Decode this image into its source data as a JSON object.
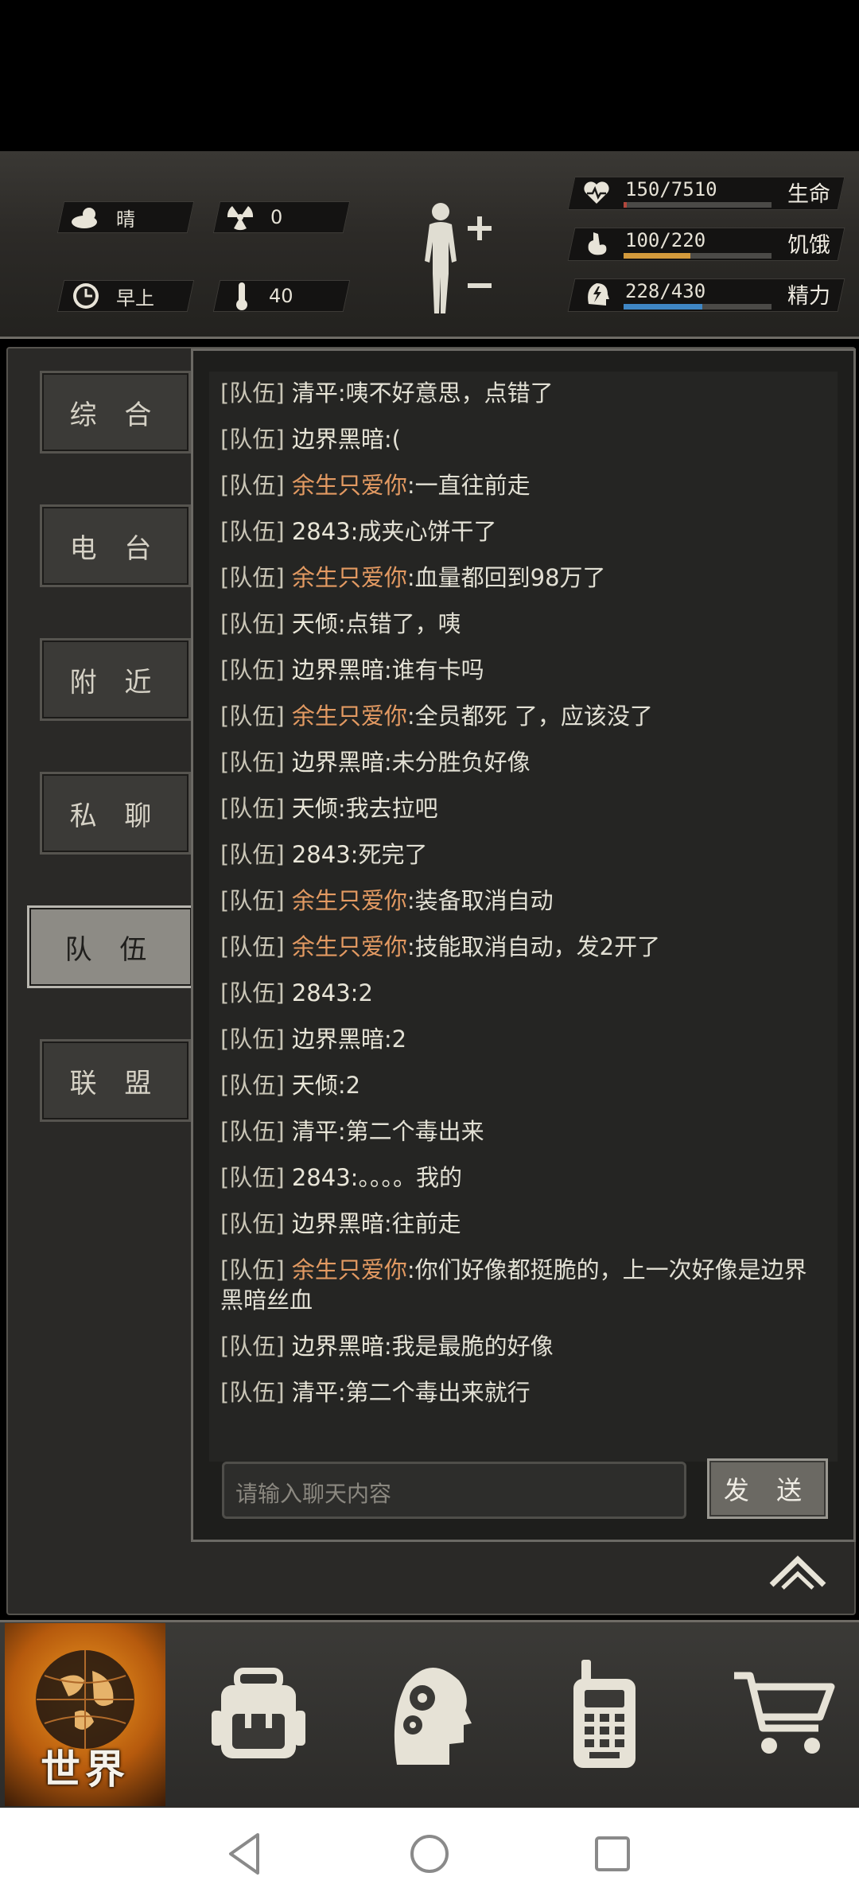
{
  "status": {
    "weather": "晴",
    "radiation": "0",
    "time_of_day": "早上",
    "temperature": "40"
  },
  "stats": [
    {
      "value": "150/7510",
      "label": "生命",
      "icon": "heart-pulse-icon",
      "fraction": 0.02,
      "color": "#b2473c"
    },
    {
      "value": "100/220",
      "label": "饥饿",
      "icon": "stomach-icon",
      "fraction": 0.45,
      "color": "#d39a3c"
    },
    {
      "value": "228/430",
      "label": "精力",
      "icon": "energy-head-icon",
      "fraction": 0.53,
      "color": "#3f86c4"
    }
  ],
  "tabs": [
    "综 合",
    "电 台",
    "附 近",
    "私 聊",
    "队 伍",
    "联 盟"
  ],
  "active_tab": "队 伍",
  "messages": [
    {
      "tag": "[队伍]",
      "name": "清平",
      "self": false,
      "text": ":咦不好意思，点错了"
    },
    {
      "tag": "[队伍]",
      "name": "边界黑暗",
      "self": false,
      "text": ":("
    },
    {
      "tag": "[队伍]",
      "name": "余生只爱你",
      "self": true,
      "text": ":一直往前走"
    },
    {
      "tag": "[队伍]",
      "name": "2843",
      "self": false,
      "text": ":成夹心饼干了"
    },
    {
      "tag": "[队伍]",
      "name": "余生只爱你",
      "self": true,
      "text": ":血量都回到98万了"
    },
    {
      "tag": "[队伍]",
      "name": "天倾",
      "self": false,
      "text": ":点错了，咦"
    },
    {
      "tag": "[队伍]",
      "name": "边界黑暗",
      "self": false,
      "text": ":谁有卡吗"
    },
    {
      "tag": "[队伍]",
      "name": "余生只爱你",
      "self": true,
      "text": ":全员都死 了，应该没了"
    },
    {
      "tag": "[队伍]",
      "name": "边界黑暗",
      "self": false,
      "text": ":未分胜负好像"
    },
    {
      "tag": "[队伍]",
      "name": "天倾",
      "self": false,
      "text": ":我去拉吧"
    },
    {
      "tag": "[队伍]",
      "name": "2843",
      "self": false,
      "text": ":死完了"
    },
    {
      "tag": "[队伍]",
      "name": "余生只爱你",
      "self": true,
      "text": ":装备取消自动"
    },
    {
      "tag": "[队伍]",
      "name": "余生只爱你",
      "self": true,
      "text": ":技能取消自动，发2开了"
    },
    {
      "tag": "[队伍]",
      "name": "2843",
      "self": false,
      "text": ":2"
    },
    {
      "tag": "[队伍]",
      "name": "边界黑暗",
      "self": false,
      "text": ":2"
    },
    {
      "tag": "[队伍]",
      "name": "天倾",
      "self": false,
      "text": ":2"
    },
    {
      "tag": "[队伍]",
      "name": "清平",
      "self": false,
      "text": ":第二个毒出来"
    },
    {
      "tag": "[队伍]",
      "name": "2843",
      "self": false,
      "text": ":。。。。我的"
    },
    {
      "tag": "[队伍]",
      "name": "边界黑暗",
      "self": false,
      "text": ":往前走"
    },
    {
      "tag": "[队伍]",
      "name": "余生只爱你",
      "self": true,
      "text": ":你们好像都挺脆的，上一次好像是边界黑暗丝血"
    },
    {
      "tag": "[队伍]",
      "name": "边界黑暗",
      "self": false,
      "text": ":我是最脆的好像"
    },
    {
      "tag": "[队伍]",
      "name": "清平",
      "self": false,
      "text": ":第二个毒出来就行"
    }
  ],
  "chat_input": {
    "placeholder": "请输入聊天内容",
    "value": ""
  },
  "send_label": "发 送",
  "bottom_nav": {
    "world_label": "世界",
    "items": [
      "globe-icon",
      "backpack-icon",
      "brain-gears-icon",
      "walkie-talkie-icon",
      "cart-icon"
    ]
  }
}
